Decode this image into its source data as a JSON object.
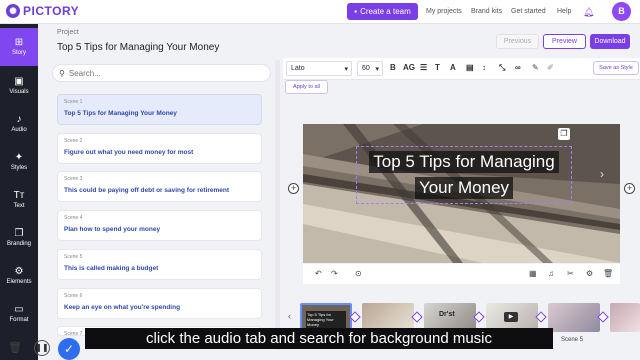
{
  "app": {
    "logo_text": "PICTORY"
  },
  "topbar": {
    "create_team": "Create a team",
    "links": [
      "My projects",
      "Brand kits",
      "Get started",
      "Help"
    ],
    "avatar_letter": "B"
  },
  "rail": {
    "items": [
      {
        "label": "Story",
        "icon": "story-icon",
        "glyph": "⊞"
      },
      {
        "label": "Visuals",
        "icon": "visuals-icon",
        "glyph": "▣"
      },
      {
        "label": "Audio",
        "icon": "audio-icon",
        "glyph": "♪"
      },
      {
        "label": "Styles",
        "icon": "styles-icon",
        "glyph": "✦"
      },
      {
        "label": "Text",
        "icon": "text-icon",
        "glyph": "Tт"
      },
      {
        "label": "Branding",
        "icon": "branding-icon",
        "glyph": "❐"
      },
      {
        "label": "Elements",
        "icon": "elements-icon",
        "glyph": "⚙"
      },
      {
        "label": "Format",
        "icon": "format-icon",
        "glyph": "▭"
      }
    ]
  },
  "project": {
    "label": "Project",
    "title": "Top 5 Tips for Managing Your Money",
    "previous": "Previous",
    "preview": "Preview",
    "download": "Download"
  },
  "scenes": {
    "search_placeholder": "Search...",
    "items": [
      {
        "num": "Scene 1",
        "text": "Top 5 Tips for Managing Your Money"
      },
      {
        "num": "Scene 2",
        "text": "Figure out what you need money for most"
      },
      {
        "num": "Scene 3",
        "text": "This could be paying off debt or saving for retirement"
      },
      {
        "num": "Scene 4",
        "text": "Plan how to spend your money"
      },
      {
        "num": "Scene 5",
        "text": "This is called making a budget"
      },
      {
        "num": "Scene 6",
        "text": "Keep an eye on what you're spending"
      },
      {
        "num": "Scene 7",
        "text": ""
      }
    ]
  },
  "editor": {
    "font": "Lato",
    "size": "60",
    "bold": "B",
    "ag": "AG",
    "save_style": "Save as Style",
    "apply_all": "Apply to all",
    "title_line1": "Top 5 Tips for Managing",
    "title_line2": "Your Money"
  },
  "timeline": {
    "thumb1_text": "Top 5 Tips for Managing Your Money",
    "thumb3_text": "Dr'st",
    "scene5_label": "Scene 5"
  },
  "caption": "click the audio tab and search for background music",
  "colors": {
    "accent": "#7a3ee6",
    "rail": "#1d1f2a"
  }
}
